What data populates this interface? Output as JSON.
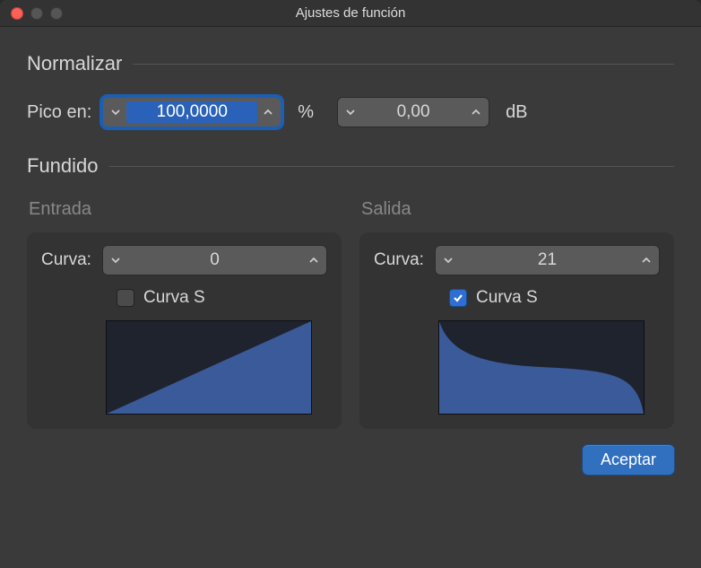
{
  "window": {
    "title": "Ajustes de función"
  },
  "sections": {
    "normalize": {
      "header": "Normalizar",
      "peak_label": "Pico en:",
      "peak_percent": "100,0000",
      "percent_unit": "%",
      "peak_db": "0,00",
      "db_unit": "dB"
    },
    "fade": {
      "header": "Fundido",
      "in": {
        "title": "Entrada",
        "curve_label": "Curva:",
        "curve_value": "0",
        "s_curve_label": "Curva S",
        "s_curve_checked": false
      },
      "out": {
        "title": "Salida",
        "curve_label": "Curva:",
        "curve_value": "21",
        "s_curve_label": "Curva S",
        "s_curve_checked": true
      }
    }
  },
  "footer": {
    "accept": "Aceptar"
  },
  "colors": {
    "accent": "#316fbf",
    "graph_fill": "#3a5a99",
    "graph_bg": "#1e232d"
  }
}
